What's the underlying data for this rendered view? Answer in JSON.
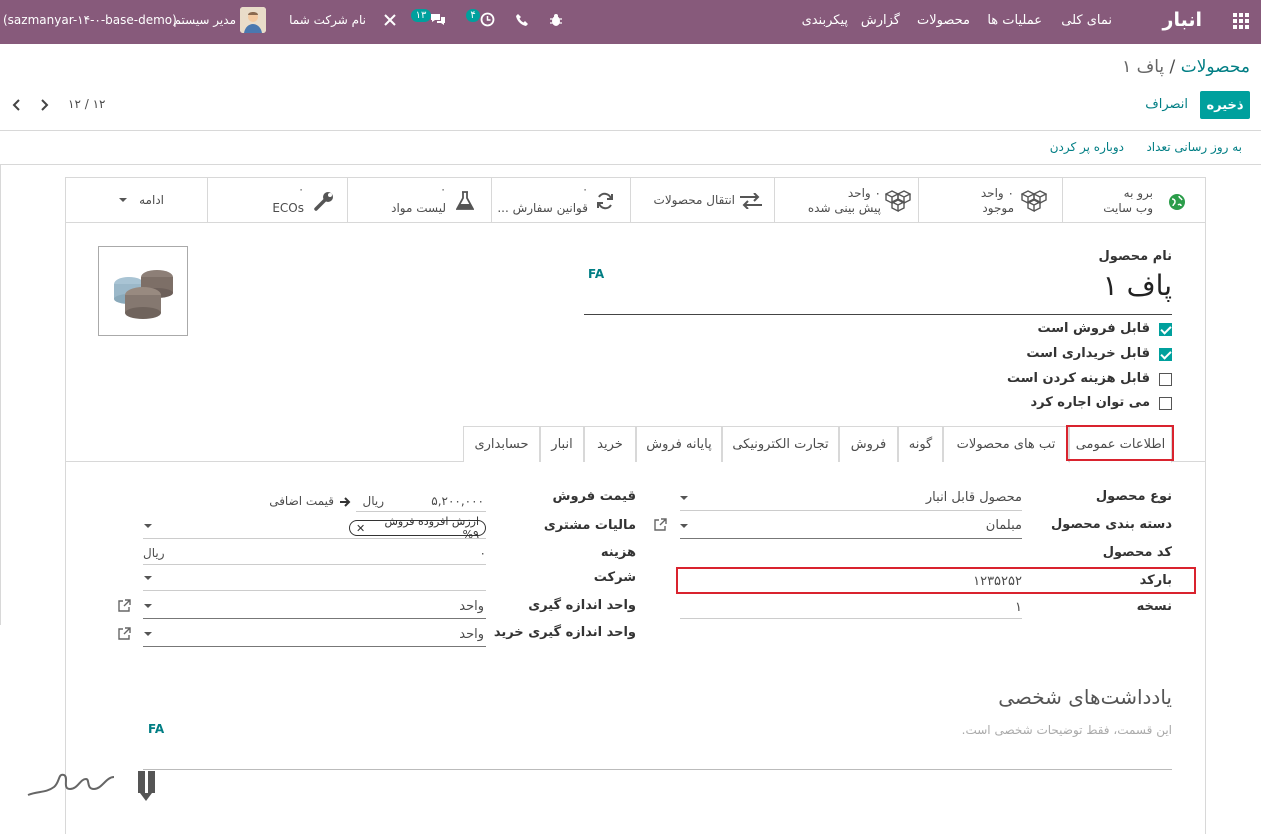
{
  "topbar": {
    "app_title": "انبار",
    "menu": [
      "نمای کلی",
      "عملیات ها",
      "محصولات",
      "گزارش",
      "پیکربندی"
    ],
    "activity_count": "۴",
    "messages_count": "۱۳",
    "company": "نام شرکت شما",
    "user": "مدیر سیستم",
    "db": "(sazmanyar-۱۴-۰-base-demo)"
  },
  "breadcrumb": {
    "parent": "محصولات",
    "separator": "/",
    "current": "پاف ۱"
  },
  "controls": {
    "save": "ذخیره",
    "discard": "انصراف",
    "pager": "۱۲ / ۱۲"
  },
  "actions": {
    "update_qty": "به روز رسانی تعداد",
    "replenish": "دوباره پر کردن"
  },
  "smart_buttons": {
    "website": {
      "line1": "برو به",
      "line2": "وب سایت"
    },
    "on_hand": {
      "value": "۰ واحد",
      "label": "موجود"
    },
    "forecasted": {
      "value": "۰ واحد",
      "label": "پیش بینی شده"
    },
    "moves": {
      "label": "انتقال محصولات"
    },
    "reordering": {
      "value": "۰",
      "label": "قوانین سفارش ..."
    },
    "bom": {
      "value": "۰",
      "label": "لیست مواد"
    },
    "ecos": {
      "value": "۰",
      "label": "ECOs"
    },
    "more": {
      "label": "ادامه"
    }
  },
  "product": {
    "name_label": "نام محصول",
    "name": "پاف ۱",
    "lang": "FA",
    "checkboxes": [
      {
        "label": "قابل فروش است",
        "checked": true
      },
      {
        "label": "قابل خریداری است",
        "checked": true
      },
      {
        "label": "قابل هزینه کردن است",
        "checked": false
      },
      {
        "label": "می توان اجاره کرد",
        "checked": false
      }
    ]
  },
  "tabs": [
    "اطلاعات عمومی",
    "تب های محصولات",
    "گونه",
    "فروش",
    "تجارت الکترونیکی",
    "پایانه فروش",
    "خرید",
    "انبار",
    "حسابداری"
  ],
  "general": {
    "product_type": {
      "label": "نوع محصول",
      "value": "محصول قابل انبار"
    },
    "category": {
      "label": "دسته بندی محصول",
      "value": "مبلمان"
    },
    "ref": {
      "label": "کد محصول",
      "value": ""
    },
    "barcode": {
      "label": "بارکد",
      "value": "۱۲۳۵۲۵۲"
    },
    "version": {
      "label": "نسخه",
      "value": "۱"
    },
    "sales_price": {
      "label": "قیمت فروش",
      "value": "۵,۲۰۰,۰۰۰",
      "currency": "ریال",
      "extra": "قیمت اضافی"
    },
    "customer_taxes": {
      "label": "مالیات مشتری",
      "tag": "ارزش افزوده فروش ۹%"
    },
    "cost": {
      "label": "هزینه",
      "value": "۰",
      "currency": "ریال"
    },
    "company": {
      "label": "شرکت",
      "value": ""
    },
    "uom": {
      "label": "واحد اندازه گیری",
      "value": "واحد"
    },
    "purchase_uom": {
      "label": "واحد اندازه گیری خرید",
      "value": "واحد"
    }
  },
  "notes": {
    "title": "یادداشت‌های شخصی",
    "placeholder": "این قسمت، فقط توضیحات شخصی است.",
    "lang": "FA"
  },
  "colors": {
    "brand": "#875a7b",
    "primary": "#00a09d",
    "link": "#017e84",
    "highlight": "#d9232e"
  }
}
